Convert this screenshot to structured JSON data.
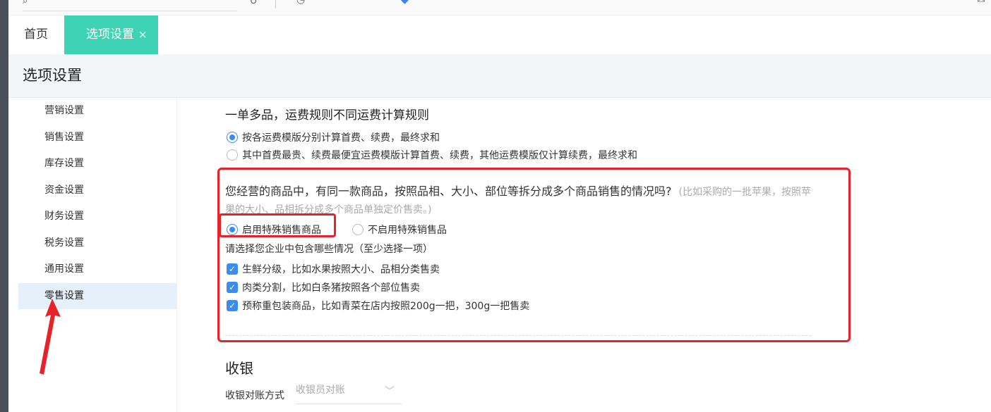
{
  "tabs": {
    "home": "首页",
    "active": "选项设置",
    "active_close": "×"
  },
  "page_title": "选项设置",
  "sidebar": {
    "items": [
      {
        "label": "营销设置"
      },
      {
        "label": "销售设置"
      },
      {
        "label": "库存设置"
      },
      {
        "label": "资金设置"
      },
      {
        "label": "财务设置"
      },
      {
        "label": "税务设置"
      },
      {
        "label": "通用设置"
      },
      {
        "label": "零售设置",
        "active": true
      }
    ]
  },
  "freight": {
    "title": "一单多品，运费规则不同运费计算规则",
    "options": [
      {
        "label": "按各运费模版分别计算首费、续费，最终求和",
        "checked": true
      },
      {
        "label": "其中首费最贵、续费最便宜运费模版计算首费、续费，其他运费模版仅计算续费，最终求和",
        "checked": false
      }
    ]
  },
  "special_sale": {
    "question": "您经营的商品中，有同一款商品，按照品相、大小、部位等拆分成多个商品销售的情况吗?",
    "hint": "(比如采购的一批苹果，按照苹果的大小、品相拆分成多个商品单独定价售卖。)",
    "options": [
      {
        "label": "启用特殊销售商品",
        "checked": true
      },
      {
        "label": "不启用特殊销售品",
        "checked": false
      }
    ],
    "sub_label": "请选择您企业中包含哪些情况（至少选择一项）",
    "checks": [
      {
        "label": "生鲜分级，比如水果按照大小、品相分类售卖",
        "checked": true
      },
      {
        "label": "肉类分割，比如白条猪按照各个部位售卖",
        "checked": true
      },
      {
        "label": "预称重包装商品，比如青菜在店内按照200g一把，300g一把售卖",
        "checked": true
      }
    ]
  },
  "cashier": {
    "title": "收银",
    "field_label": "收银对账方式",
    "select_value": "收银员对账"
  },
  "colors": {
    "accent_tab": "#3fd3b5",
    "primary": "#3b8cf0",
    "highlight": "#e8222a"
  }
}
